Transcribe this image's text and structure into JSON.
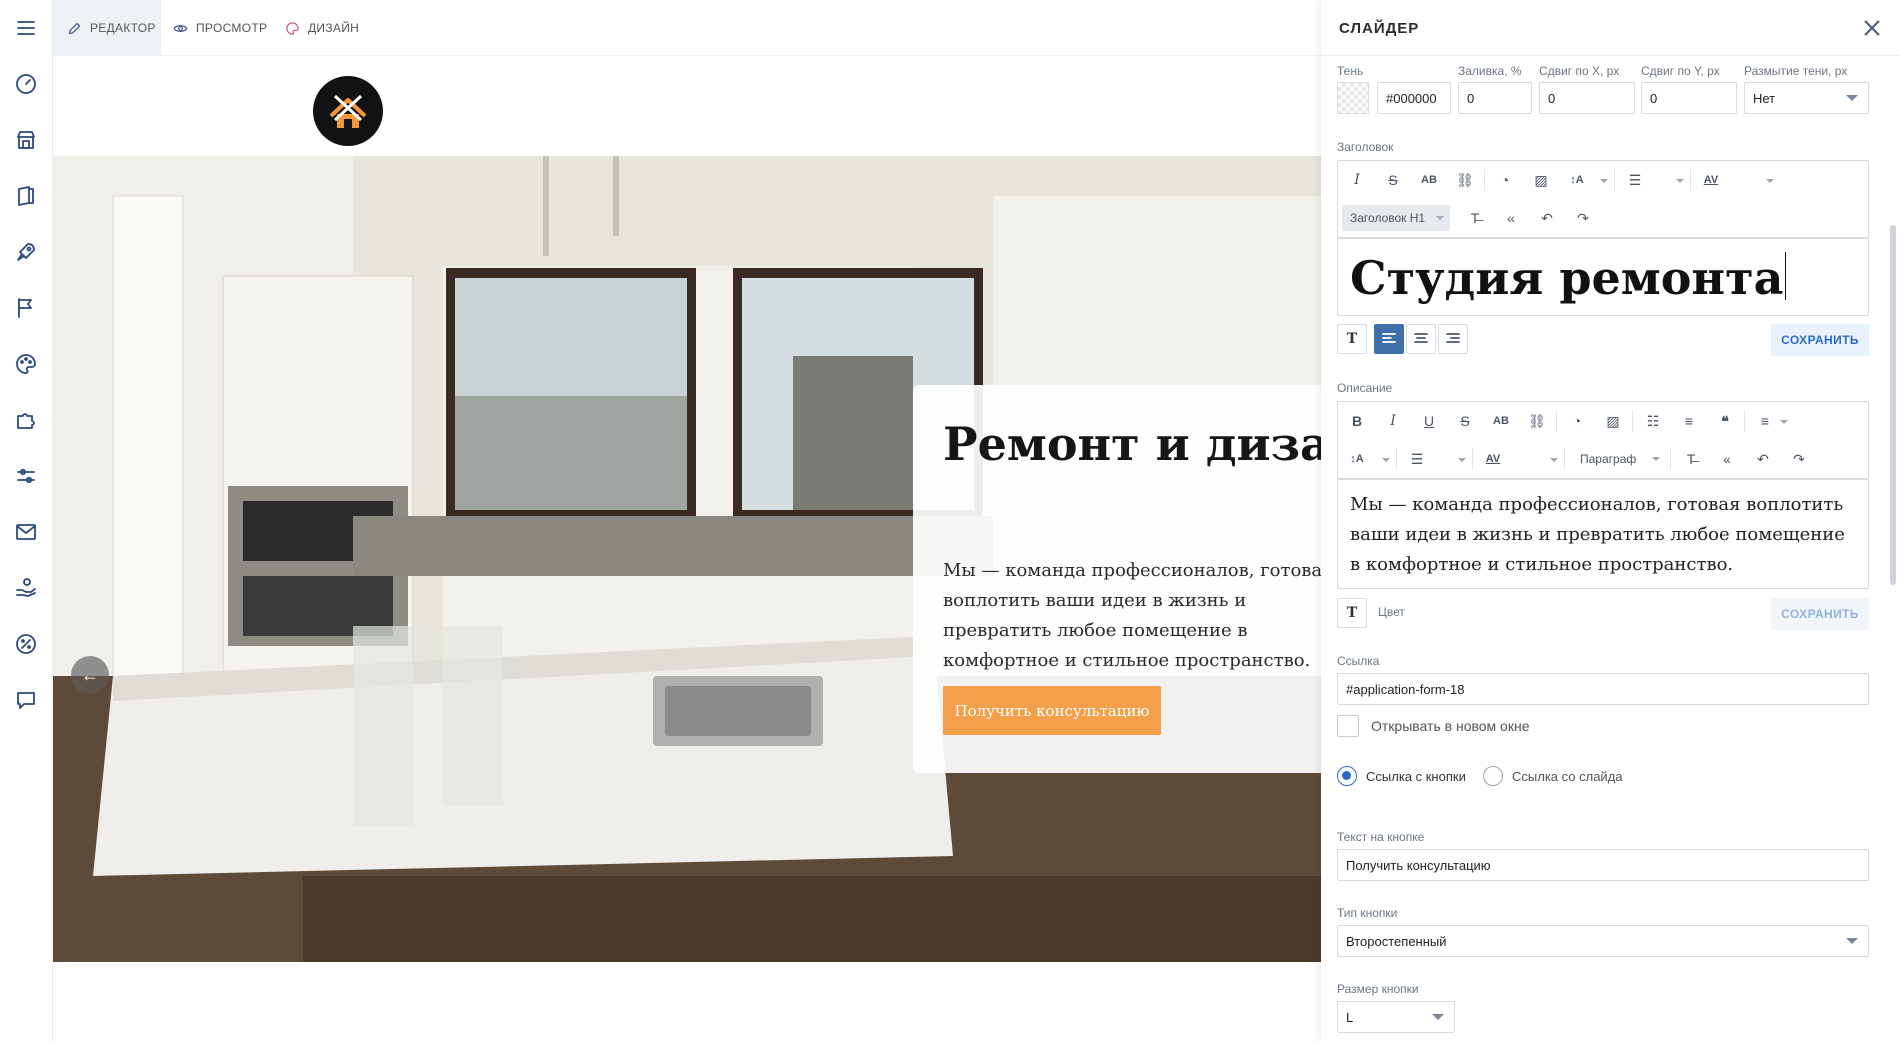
{
  "topbar": {
    "tabs": [
      {
        "label": "РЕДАКТОР",
        "icon": "pencil-icon",
        "active": true
      },
      {
        "label": "ПРОСМОТР",
        "icon": "eye-icon",
        "active": false
      },
      {
        "label": "ДИЗАЙН",
        "icon": "palette-icon",
        "active": false
      }
    ]
  },
  "rail": {
    "icons": [
      "menu-icon",
      "dashboard-icon",
      "store-icon",
      "pages-icon",
      "rocket-icon",
      "flag-icon",
      "palette-icon",
      "puzzle-icon",
      "settings-sliders-icon",
      "mail-icon",
      "hand-coin-icon",
      "percent-icon",
      "chat-icon"
    ]
  },
  "hero": {
    "title": "Ремонт и дизайн интерьера в Москве",
    "description": "Мы — команда профессионалов, готовая воплотить ваши идеи в жизнь и превратить любое помещение в комфортное и стильное пространство.",
    "button": "Получить консультацию",
    "prev_arrow": "←"
  },
  "panel": {
    "title": "СЛАЙДЕР",
    "shadow": {
      "label": "Тень",
      "color": "#000000",
      "fill_label": "Заливка, %",
      "fill": "0",
      "x_label": "Сдвиг по X, px",
      "x": "0",
      "y_label": "Сдвиг по Y, px",
      "y": "0",
      "blur_label": "Размытие тени, px",
      "blur": "Нет"
    },
    "heading": {
      "label": "Заголовок",
      "style": "Заголовок H1",
      "text": "Студия ремонта",
      "save": "СОХРАНИТЬ"
    },
    "description": {
      "label": "Описание",
      "style": "Параграф",
      "text": "Мы — команда профессионалов, готовая воплотить ваши идеи в жизнь и превратить любое помещение в комфортное и стильное пространство.",
      "color_label": "Цвет",
      "save": "СОХРАНИТЬ"
    },
    "link": {
      "label": "Ссылка",
      "value": "#application-form-18",
      "new_window": "Открывать в новом окне",
      "radio_button": "Ссылка с кнопки",
      "radio_slide": "Ссылка со слайда"
    },
    "button_text": {
      "label": "Текст на кнопке",
      "value": "Получить консультацию"
    },
    "button_type": {
      "label": "Тип кнопки",
      "value": "Второстепенный"
    },
    "button_size": {
      "label": "Размер кнопки",
      "value": "L"
    }
  },
  "colors": {
    "accent": "#f4a04b",
    "primary": "#2a6bc2",
    "icon": "#2b4a7a"
  }
}
